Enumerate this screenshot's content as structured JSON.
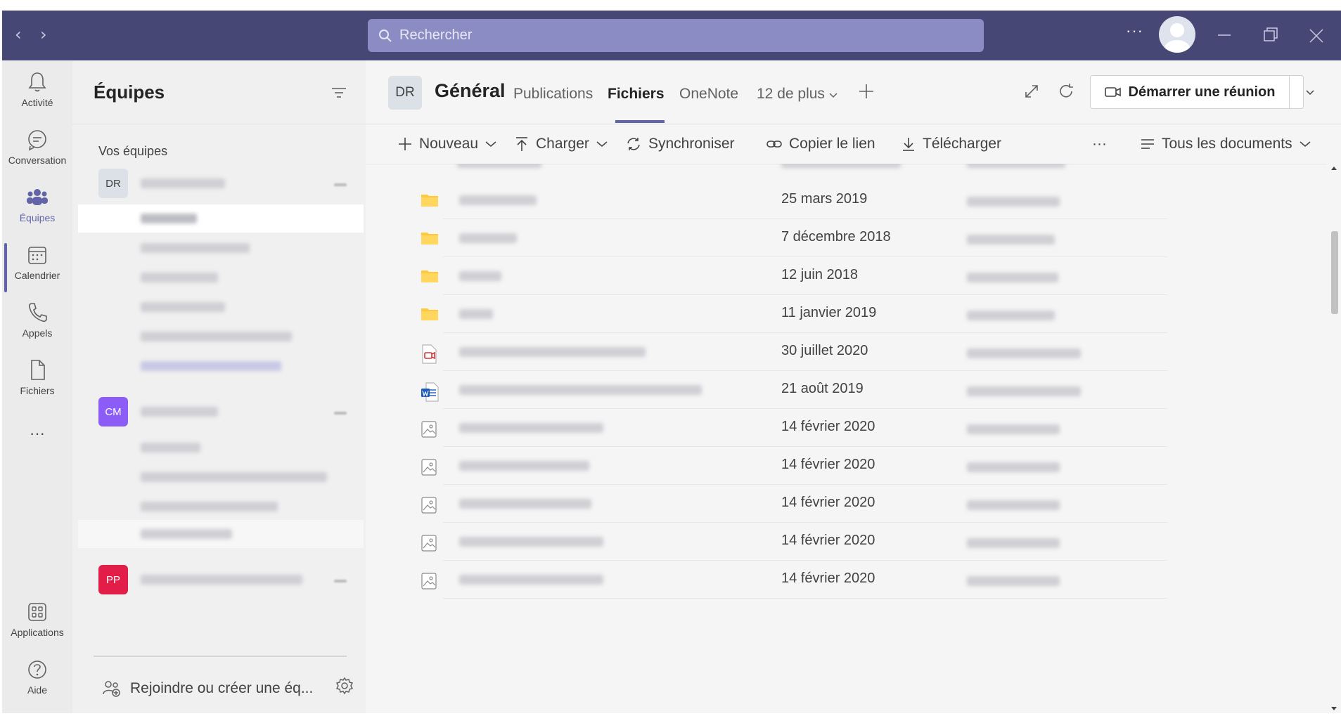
{
  "topbar": {
    "search_placeholder": "Rechercher",
    "more": "···"
  },
  "rail": {
    "items": [
      {
        "label": "Activité"
      },
      {
        "label": "Conversation"
      },
      {
        "label": "Équipes"
      },
      {
        "label": "Calendrier"
      },
      {
        "label": "Appels"
      },
      {
        "label": "Fichiers"
      }
    ],
    "more": "···",
    "apps_label": "Applications",
    "help_label": "Aide",
    "accent": "#6264a7"
  },
  "teams_panel": {
    "title": "Équipes",
    "section_label": "Vos équipes",
    "teams": [
      {
        "initials": "DR",
        "color": "#dbe1e6",
        "text_color": "#424242"
      },
      {
        "initials": "CM",
        "color": "#8b5cf6",
        "text_color": "#ffffff"
      },
      {
        "initials": "PP",
        "color": "#e11d48",
        "text_color": "#ffffff"
      }
    ],
    "join_label": "Rejoindre ou créer une éq..."
  },
  "channel": {
    "avatar": "DR",
    "name": "Général",
    "tabs": [
      "Publications",
      "Fichiers",
      "OneNote",
      "12 de plus"
    ],
    "active_tab": "Fichiers",
    "meet_label": "Démarrer une réunion"
  },
  "toolbar": {
    "new_label": "Nouveau",
    "upload_label": "Charger",
    "sync_label": "Synchroniser",
    "copy_link_label": "Copier le lien",
    "download_label": "Télécharger",
    "more": "···",
    "view_label": "Tous les documents"
  },
  "files": [
    {
      "type": "folder-icon",
      "date": "25 mars 2019"
    },
    {
      "type": "folder-icon",
      "date": "7 décembre 2018"
    },
    {
      "type": "folder-icon",
      "date": "12 juin 2018"
    },
    {
      "type": "folder-icon",
      "date": "11 janvier 2019"
    },
    {
      "type": "video-file-icon",
      "date": "30 juillet 2020"
    },
    {
      "type": "word-file-icon",
      "date": "21 août 2019"
    },
    {
      "type": "image-file-icon",
      "date": "14 février 2020"
    },
    {
      "type": "image-file-icon",
      "date": "14 février 2020"
    },
    {
      "type": "image-file-icon",
      "date": "14 février 2020"
    },
    {
      "type": "image-file-icon",
      "date": "14 février 2020"
    },
    {
      "type": "image-file-icon",
      "date": "14 février 2020"
    }
  ],
  "colors": {
    "titlebar": "#464775",
    "search": "#8b8cc4",
    "folder": "#ffc83d",
    "word": "#185abd",
    "video": "#d13438"
  }
}
